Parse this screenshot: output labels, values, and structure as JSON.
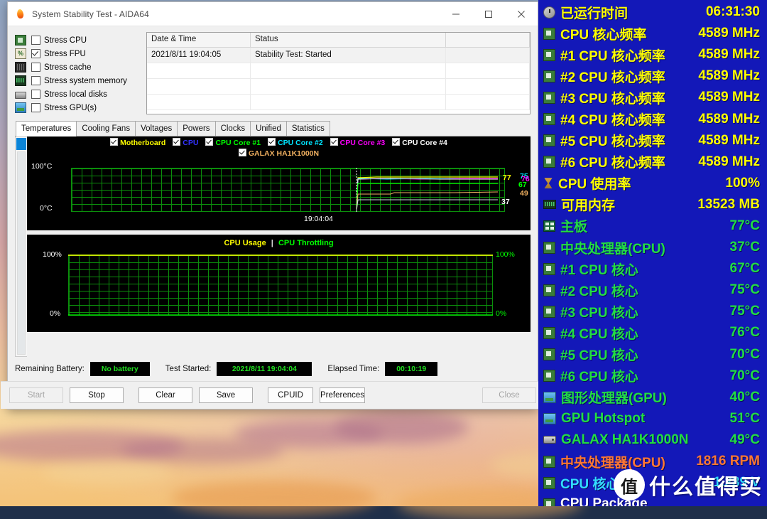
{
  "window": {
    "title": "System Stability Test - AIDA64",
    "logo_icon": "aida64-flame-icon",
    "minimize": "–",
    "maximize": "□",
    "close": "×"
  },
  "stress_options": [
    {
      "label": "Stress CPU",
      "checked": false,
      "icon": "cpu-icon"
    },
    {
      "label": "Stress FPU",
      "checked": true,
      "icon": "fpu-icon"
    },
    {
      "label": "Stress cache",
      "checked": false,
      "icon": "cache-icon"
    },
    {
      "label": "Stress system memory",
      "checked": false,
      "icon": "memory-icon"
    },
    {
      "label": "Stress local disks",
      "checked": false,
      "icon": "disk-icon"
    },
    {
      "label": "Stress GPU(s)",
      "checked": false,
      "icon": "gpu-icon"
    }
  ],
  "log": {
    "columns": [
      "Date & Time",
      "Status",
      ""
    ],
    "rows": [
      {
        "datetime": "2021/8/11 19:04:05",
        "status": "Stability Test: Started"
      }
    ]
  },
  "tabs": [
    {
      "label": "Temperatures",
      "active": true
    },
    {
      "label": "Cooling Fans",
      "active": false
    },
    {
      "label": "Voltages",
      "active": false
    },
    {
      "label": "Powers",
      "active": false
    },
    {
      "label": "Clocks",
      "active": false
    },
    {
      "label": "Unified",
      "active": false
    },
    {
      "label": "Statistics",
      "active": false
    }
  ],
  "temp_chart": {
    "y_top_label": "100°C",
    "y_bottom_label": "0°C",
    "x_label": "19:04:04",
    "legend": [
      {
        "label": "Motherboard",
        "color": "#ffff00",
        "checked": true
      },
      {
        "label": "CPU",
        "color": "#3333ff",
        "checked": true
      },
      {
        "label": "CPU Core #1",
        "color": "#00ff00",
        "checked": true
      },
      {
        "label": "CPU Core #2",
        "color": "#00e5ff",
        "checked": true
      },
      {
        "label": "CPU Core #3",
        "color": "#ff00ff",
        "checked": true
      },
      {
        "label": "CPU Core #4",
        "color": "#ffffff",
        "checked": true
      },
      {
        "label": "GALAX HA1K1000N",
        "color": "#f0b060",
        "checked": true
      }
    ],
    "value_labels": [
      {
        "text": "77",
        "color": "#ffff00"
      },
      {
        "text": "75",
        "color": "#00e5ff"
      },
      {
        "text": "76",
        "color": "#ff00ff"
      },
      {
        "text": "67",
        "color": "#00ff00"
      },
      {
        "text": "49",
        "color": "#f0b060"
      },
      {
        "text": "37",
        "color": "#ffffff"
      }
    ]
  },
  "usage_chart": {
    "title_usage": "CPU Usage",
    "title_sep": "|",
    "title_throttling": "CPU Throttling",
    "y_top_left": "100%",
    "y_bottom_left": "0%",
    "y_top_right": "100%",
    "y_bottom_right": "0%",
    "usage_color": "#ffff00",
    "throttling_color": "#00ff00"
  },
  "status": {
    "battery_label": "Remaining Battery:",
    "battery_value": "No battery",
    "started_label": "Test Started:",
    "started_value": "2021/8/11 19:04:04",
    "elapsed_label": "Elapsed Time:",
    "elapsed_value": "00:10:19"
  },
  "buttons": [
    {
      "label": "Start",
      "disabled": true
    },
    {
      "label": "Stop",
      "disabled": false
    },
    {
      "label": "Clear",
      "disabled": false
    },
    {
      "label": "Save",
      "disabled": false
    },
    {
      "label": "CPUID",
      "disabled": false
    },
    {
      "label": "Preferences",
      "disabled": false
    },
    {
      "label": "Close",
      "disabled": true
    }
  ],
  "osd": {
    "bg_color": "#1318b8",
    "rows": [
      {
        "icon": "clock-icon",
        "label": "已运行时间",
        "value": "06:31:30",
        "color": "#ffff00"
      },
      {
        "icon": "chip-icon",
        "label": "CPU 核心频率",
        "value": "4589 MHz",
        "color": "#ffff00"
      },
      {
        "icon": "chip-icon",
        "label": "#1 CPU 核心频率",
        "value": "4589 MHz",
        "color": "#ffff00"
      },
      {
        "icon": "chip-icon",
        "label": "#2 CPU 核心频率",
        "value": "4589 MHz",
        "color": "#ffff00"
      },
      {
        "icon": "chip-icon",
        "label": "#3 CPU 核心频率",
        "value": "4589 MHz",
        "color": "#ffff00"
      },
      {
        "icon": "chip-icon",
        "label": "#4 CPU 核心频率",
        "value": "4589 MHz",
        "color": "#ffff00"
      },
      {
        "icon": "chip-icon",
        "label": "#5 CPU 核心频率",
        "value": "4589 MHz",
        "color": "#ffff00"
      },
      {
        "icon": "chip-icon",
        "label": "#6 CPU 核心频率",
        "value": "4589 MHz",
        "color": "#ffff00"
      },
      {
        "icon": "hourglass-icon",
        "label": "CPU 使用率",
        "value": "100%",
        "color": "#ffff00"
      },
      {
        "icon": "memory-icon",
        "label": "可用内存",
        "value": "13523 MB",
        "color": "#ffff00"
      },
      {
        "icon": "motherboard-icon",
        "label": "主板",
        "value": "77°C",
        "color": "#22dd44"
      },
      {
        "icon": "chip-icon",
        "label": "中央处理器(CPU)",
        "value": "37°C",
        "color": "#22dd44"
      },
      {
        "icon": "chip-icon",
        "label": "#1 CPU 核心",
        "value": "67°C",
        "color": "#22dd44"
      },
      {
        "icon": "chip-icon",
        "label": "#2 CPU 核心",
        "value": "75°C",
        "color": "#22dd44"
      },
      {
        "icon": "chip-icon",
        "label": "#3 CPU 核心",
        "value": "75°C",
        "color": "#22dd44"
      },
      {
        "icon": "chip-icon",
        "label": "#4 CPU 核心",
        "value": "76°C",
        "color": "#22dd44"
      },
      {
        "icon": "chip-icon",
        "label": "#5 CPU 核心",
        "value": "70°C",
        "color": "#22dd44"
      },
      {
        "icon": "chip-icon",
        "label": "#6 CPU 核心",
        "value": "70°C",
        "color": "#22dd44"
      },
      {
        "icon": "gpu-icon",
        "label": "图形处理器(GPU)",
        "value": "40°C",
        "color": "#22dd44"
      },
      {
        "icon": "gpu-icon",
        "label": "GPU Hotspot",
        "value": "51°C",
        "color": "#22dd44"
      },
      {
        "icon": "disk-icon",
        "label": "GALAX HA1K1000N",
        "value": "49°C",
        "color": "#22dd44"
      },
      {
        "icon": "chip-icon",
        "label": "中央处理器(CPU)",
        "value": "1816 RPM",
        "color": "#ff7733"
      },
      {
        "icon": "chip-icon",
        "label": "CPU 核心",
        "value": "1.289 V",
        "color": "#33ddff"
      },
      {
        "icon": "chip-icon",
        "label": "CPU Package",
        "value": "",
        "color": "#ffffff"
      }
    ]
  },
  "watermark": {
    "badge": "值",
    "text": "什么值得买"
  }
}
